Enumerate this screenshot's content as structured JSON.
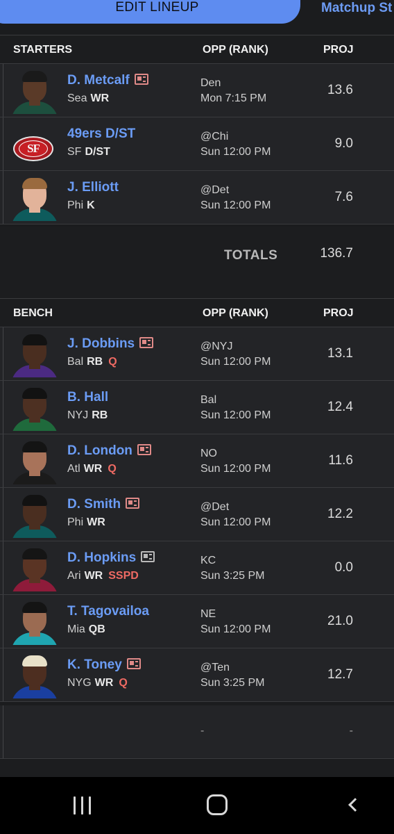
{
  "tabs": {
    "active": "EDIT LINEUP",
    "other": "Matchup St"
  },
  "starters_header": {
    "title": "STARTERS",
    "opp": "OPP (RANK)",
    "proj": "PROJ"
  },
  "starters": [
    {
      "name": "D. Metcalf",
      "team": "Sea",
      "pos": "WR",
      "status": "",
      "opp": "Den",
      "time": "Mon 7:15 PM",
      "proj": "13.6",
      "news": "red",
      "avatar": "player",
      "skin": "#5a3a28",
      "jersey": "#1d4f3e",
      "hair": "#1a1a1a"
    },
    {
      "name": "49ers D/ST",
      "team": "SF",
      "pos": "D/ST",
      "status": "",
      "opp": "@Chi",
      "time": "Sun 12:00 PM",
      "proj": "9.0",
      "news": "",
      "avatar": "logo",
      "logo_text": "SF"
    },
    {
      "name": "J. Elliott",
      "team": "Phi",
      "pos": "K",
      "status": "",
      "opp": "@Det",
      "time": "Sun 12:00 PM",
      "proj": "7.6",
      "news": "",
      "avatar": "player",
      "skin": "#e2b39a",
      "jersey": "#0e5b5c",
      "hair": "#9a6a3e"
    }
  ],
  "totals": {
    "label": "TOTALS",
    "value": "136.7"
  },
  "bench_header": {
    "title": "BENCH",
    "opp": "OPP (RANK)",
    "proj": "PROJ"
  },
  "bench": [
    {
      "name": "J. Dobbins",
      "team": "Bal",
      "pos": "RB",
      "status": "Q",
      "opp": "@NYJ",
      "time": "Sun 12:00 PM",
      "proj": "13.1",
      "news": "red",
      "avatar": "player",
      "skin": "#4a2e20",
      "jersey": "#4b2a82",
      "hair": "#121212"
    },
    {
      "name": "B. Hall",
      "team": "NYJ",
      "pos": "RB",
      "status": "",
      "opp": "Bal",
      "time": "Sun 12:00 PM",
      "proj": "12.4",
      "news": "",
      "avatar": "player",
      "skin": "#4d3022",
      "jersey": "#1f6a3c",
      "hair": "#121212"
    },
    {
      "name": "D. London",
      "team": "Atl",
      "pos": "WR",
      "status": "Q",
      "opp": "NO",
      "time": "Sun 12:00 PM",
      "proj": "11.6",
      "news": "red",
      "avatar": "player",
      "skin": "#a8735a",
      "jersey": "#1b1b1b",
      "hair": "#141414"
    },
    {
      "name": "D. Smith",
      "team": "Phi",
      "pos": "WR",
      "status": "",
      "opp": "@Det",
      "time": "Sun 12:00 PM",
      "proj": "12.2",
      "news": "red",
      "avatar": "player",
      "skin": "#4a2e20",
      "jersey": "#0e5b5c",
      "hair": "#121212"
    },
    {
      "name": "D. Hopkins",
      "team": "Ari",
      "pos": "WR",
      "status": "SSPD",
      "opp": "KC",
      "time": "Sun 3:25 PM",
      "proj": "0.0",
      "news": "gray",
      "avatar": "player",
      "skin": "#5a3424",
      "jersey": "#8e1b3a",
      "hair": "#151515"
    },
    {
      "name": "T. Tagovailoa",
      "team": "Mia",
      "pos": "QB",
      "status": "",
      "opp": "NE",
      "time": "Sun 12:00 PM",
      "proj": "21.0",
      "news": "",
      "avatar": "player",
      "skin": "#9b6b52",
      "jersey": "#1fa5b0",
      "hair": "#141414"
    },
    {
      "name": "K. Toney",
      "team": "NYG",
      "pos": "WR",
      "status": "Q",
      "opp": "@Ten",
      "time": "Sun 3:25 PM",
      "proj": "12.7",
      "news": "red",
      "avatar": "player",
      "skin": "#4d2e20",
      "jersey": "#1a3fa0",
      "hair": "#e8e0c8"
    }
  ],
  "empty_slot": {
    "opp": "-",
    "proj": "-"
  },
  "nav": {
    "recents": "recents-icon",
    "home": "home-icon",
    "back": "back-icon"
  },
  "colors": {
    "accent": "#5e8cf0",
    "link": "#6b9cf5",
    "status_red": "#ee6a63",
    "background": "#1b1c1e",
    "row": "#232427"
  }
}
